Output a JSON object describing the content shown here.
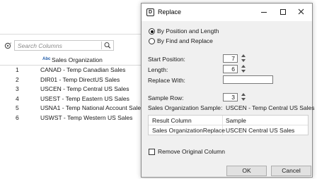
{
  "background": {
    "search": {
      "placeholder": "Search Columns"
    },
    "column": {
      "type_badge": "Abc",
      "name": "Sales Organization"
    },
    "rows": [
      {
        "num": "1",
        "value": "CANAD - Temp Canadian Sales"
      },
      {
        "num": "2",
        "value": "DIR01 - Temp DirectUS Sales"
      },
      {
        "num": "3",
        "value": "USCEN - Temp Central US Sales"
      },
      {
        "num": "4",
        "value": "USEST - Temp Eastern US Sales"
      },
      {
        "num": "5",
        "value": "USNA1 - Temp National Account Sales"
      },
      {
        "num": "6",
        "value": "USWST - Temp Western US Sales"
      }
    ]
  },
  "dialog": {
    "title": "Replace",
    "app_icon_letter": "D",
    "options": {
      "by_position": "By Position and Length",
      "by_find": "By Find and Replace",
      "selected": "by_position"
    },
    "fields": {
      "start_position_label": "Start Position:",
      "start_position_value": "7",
      "length_label": "Length:",
      "length_value": "6",
      "replace_with_label": "Replace With:",
      "replace_with_value": "",
      "sample_row_label": "Sample Row:",
      "sample_row_value": "3"
    },
    "sample": {
      "label": "Sales Organization Sample:",
      "value": "USCEN - Temp Central US Sales"
    },
    "result_table": {
      "headers": [
        "Result Column",
        "Sample"
      ],
      "row": [
        "Sales OrganizationReplace",
        "USCEN  Central US Sales"
      ]
    },
    "remove_original_label": "Remove Original Column",
    "ok_label": "OK",
    "cancel_label": "Cancel"
  },
  "colors": {
    "type_badge": "#1e5aa8",
    "dialog_bg": "#f0f0f0",
    "titlebar_bg": "#ffffff"
  }
}
